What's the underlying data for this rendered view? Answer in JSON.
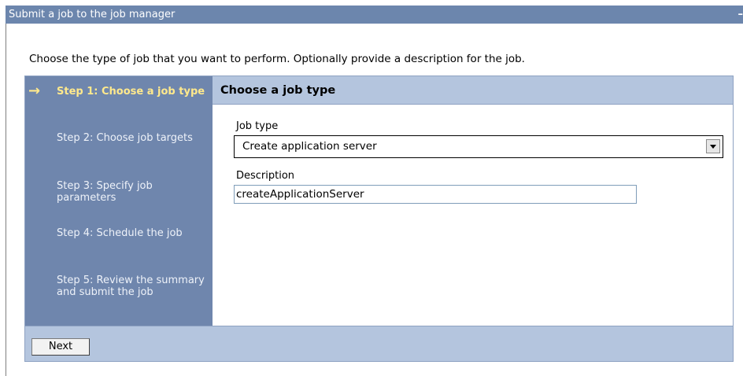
{
  "window": {
    "title": "Submit a job to the job manager",
    "minimize_glyph": "–"
  },
  "instruction": "Choose the type of job that you want to perform. Optionally provide a description for the job.",
  "steps": [
    {
      "label": "Step 1: Choose a job type",
      "active": true
    },
    {
      "label": "Step 2: Choose job targets",
      "active": false
    },
    {
      "label": "Step 3: Specify job parameters",
      "active": false
    },
    {
      "label": "Step 4: Schedule the job",
      "active": false
    },
    {
      "label": "Step 5: Review the summary and submit the job",
      "active": false
    }
  ],
  "current_step_marker": "→",
  "panel": {
    "title": "Choose a job type",
    "job_type": {
      "label": "Job type",
      "selected": "Create application server"
    },
    "description": {
      "label": "Description",
      "value": "createApplicationServer"
    }
  },
  "footer": {
    "next_label": "Next"
  },
  "colors": {
    "title_bar": "#6c86ad",
    "steps_panel": "#6f86ad",
    "active_step": "#ffe98c",
    "header_band": "#b4c5de"
  }
}
